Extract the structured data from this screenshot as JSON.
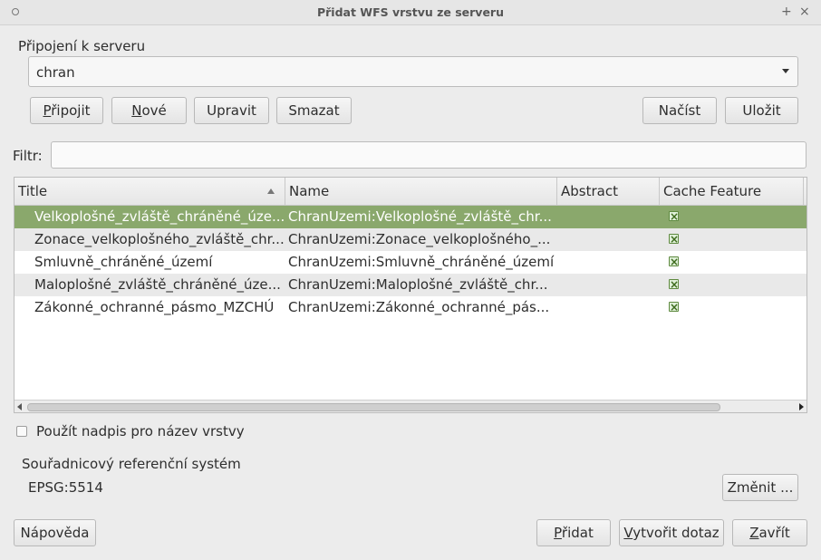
{
  "window": {
    "title": "Přidat WFS vrstvu ze serveru",
    "controls": [
      "+",
      "×"
    ]
  },
  "connection": {
    "label": "Připojení k serveru",
    "selected": "chran",
    "buttons": {
      "connect": {
        "pre": "",
        "mnemonic": "P",
        "post": "řipojit"
      },
      "new": {
        "pre": "",
        "mnemonic": "N",
        "post": "ové"
      },
      "edit": {
        "pre": "Upravit",
        "mnemonic": "",
        "post": ""
      },
      "delete": {
        "pre": "Smazat",
        "mnemonic": "",
        "post": ""
      },
      "load": {
        "pre": "Načíst",
        "mnemonic": "",
        "post": ""
      },
      "save": {
        "pre": "Uložit",
        "mnemonic": "",
        "post": ""
      }
    }
  },
  "filter": {
    "label": "Filtr:",
    "value": ""
  },
  "table": {
    "columns": [
      "Title",
      "Name",
      "Abstract",
      "Cache Feature"
    ],
    "rows": [
      {
        "title": "Velkoplošné_zvláště_chráněné_úze...",
        "name": "ChranUzemi:Velkoplošné_zvláště_chr...",
        "abstract": "",
        "cache": true,
        "selected": true
      },
      {
        "title": "Zonace_velkoplošného_zvláště_chr...",
        "name": "ChranUzemi:Zonace_velkoplošného_...",
        "abstract": "",
        "cache": true,
        "selected": false
      },
      {
        "title": "Smluvně_chráněné_území",
        "name": "ChranUzemi:Smluvně_chráněné_území",
        "abstract": "",
        "cache": true,
        "selected": false
      },
      {
        "title": "Maloplošné_zvláště_chráněné_úze...",
        "name": "ChranUzemi:Maloplošné_zvláště_chr...",
        "abstract": "",
        "cache": true,
        "selected": false
      },
      {
        "title": "Zákonné_ochranné_pásmo_MZCHÚ",
        "name": "ChranUzemi:Zákonné_ochranné_pás...",
        "abstract": "",
        "cache": true,
        "selected": false
      }
    ]
  },
  "options": {
    "use_title_label": "Použít nadpis pro název vrstvy",
    "use_title_checked": false
  },
  "crs": {
    "label": "Souřadnicový referenční systém",
    "value": "EPSG:5514",
    "change_button": "Změnit ..."
  },
  "footer": {
    "help": "Nápověda",
    "add": {
      "pre": "",
      "mnemonic": "P",
      "post": "řidat"
    },
    "build_query": {
      "pre": "",
      "mnemonic": "V",
      "post": "ytvořit dotaz"
    },
    "close": {
      "pre": "",
      "mnemonic": "Z",
      "post": "avřít"
    }
  },
  "colors": {
    "selection": "#8aa86c",
    "window_bg": "#ececec"
  }
}
